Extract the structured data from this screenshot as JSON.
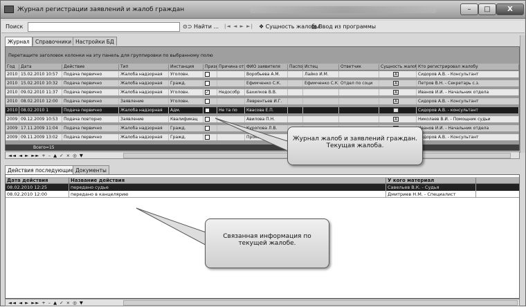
{
  "window": {
    "title": "Журнал регистрации заявлений и жалоб граждан",
    "min": "–",
    "max": "□",
    "close": "X"
  },
  "toolbar": {
    "search_label": "Поиск",
    "find": "Найти ...",
    "nav": "|◄ ◄ ► ►|",
    "entity": "Сущность жалобы",
    "input": "Ввод из программы"
  },
  "tabs_top": [
    {
      "label": "Журнал"
    },
    {
      "label": "Справочники"
    },
    {
      "label": "Настройки БД"
    }
  ],
  "grid1": {
    "group_hint": "Перетащите заголовок колонки на эту панель для группировки по выбранному полю",
    "columns": [
      "Год",
      "Дата",
      "Действие",
      "Тип",
      "Инстанция",
      "Признак",
      "Причина отказа",
      "ФИО заявителя",
      "Паспорт",
      "Истец",
      "Ответчик",
      "Сущность жалобы",
      "Кто регистрировал жалобу"
    ],
    "rows": [
      {
        "year": "2010",
        "date": "15.02.2010 10:57",
        "action": "Подача первично",
        "type": "Жалоба надзорная",
        "inst": "Уголовн.",
        "flag": "",
        "reason": "",
        "fio": "Воробьева А.М.",
        "pass": "",
        "plaintiff": "Лайко И.М.",
        "defendant": "",
        "essence": "A",
        "reg": "Сидоров А.В. - Консультант"
      },
      {
        "year": "2010",
        "date": "15.02.2010 10:32",
        "action": "Подача первично",
        "type": "Жалоба надзорная",
        "inst": "Гражд.",
        "flag": "",
        "reason": "",
        "fio": "Ефимченко С.К.",
        "pass": "",
        "plaintiff": "Ефимченко С.К.",
        "defendant": "Отдел по соци",
        "essence": "A",
        "reg": "Петров В.Н. - Секретарь с.з."
      },
      {
        "year": "2010",
        "date": "09.02.2010 11:37",
        "action": "Подача первично",
        "type": "Жалоба надзорная",
        "inst": "Уголовн.",
        "flag": "✓",
        "reason": "Недособр",
        "fio": "Бахилков В.В.",
        "pass": "",
        "plaintiff": "",
        "defendant": "",
        "essence": "A",
        "reg": "Иванов И.И. - Начальник отдела"
      },
      {
        "year": "2010",
        "date": "08.02.2010 12:00",
        "action": "Подача первично",
        "type": "Заявление",
        "inst": "Уголовн.",
        "flag": "",
        "reason": "",
        "fio": "Леврентьев И.Г.",
        "pass": "",
        "plaintiff": "",
        "defendant": "",
        "essence": "A",
        "reg": "Сидоров А.В. - Консультант"
      },
      {
        "year": "2010",
        "date": "08.02.2010 1",
        "action": "Подача первично",
        "type": "Жалоба надзорная",
        "inst": "Адм.",
        "flag": "✓",
        "reason": "Не та по",
        "fio": "Квасова Е.П.",
        "pass": "",
        "plaintiff": "",
        "defendant": "",
        "essence": "A",
        "reg": "Сидоров А.В. - консультант"
      },
      {
        "year": "2009",
        "date": "09.12.2009 10:53",
        "action": "Подача повторно",
        "type": "Заявление",
        "inst": "Квалификац",
        "flag": "",
        "reason": "",
        "fio": "Авилова П.Н.",
        "pass": "",
        "plaintiff": "",
        "defendant": "",
        "essence": "A",
        "reg": "Николаев В.И. - Помощник судьи"
      },
      {
        "year": "2009",
        "date": "17.11.2009 11:04",
        "action": "Подача первично",
        "type": "Жалоба надзорная",
        "inst": "Гражд.",
        "flag": "",
        "reason": "",
        "fio": "Куропова Л.В.",
        "pass": "",
        "plaintiff": "",
        "defendant": "",
        "essence": "A",
        "reg": "Иванов И.И. - Начальник отдела"
      },
      {
        "year": "2009",
        "date": "09.11.2009 13:02",
        "action": "Подача первично",
        "type": "Жалоба надзорная",
        "inst": "Гражд.",
        "flag": "",
        "reason": "",
        "fio": "Прокова",
        "pass": "",
        "plaintiff": "",
        "defendant": "",
        "essence": "A",
        "reg": "Сидоров А.В. - Консультант"
      }
    ],
    "total": "Всего=15"
  },
  "nav_glyphs": "◄◄ ◄ ► ►► + – ▲ ✓ × ◎ ▼",
  "tabs_bottom": [
    {
      "label": "Действия последующие"
    },
    {
      "label": "Документы"
    }
  ],
  "grid2": {
    "columns": [
      "Дата действия",
      "Название действия",
      "У кого материал"
    ],
    "rows": [
      {
        "date": "08.02.2010 12:25",
        "name": "передано судье",
        "who": "Савельев В.К. - Судья"
      },
      {
        "date": "08.02.2010 12:00",
        "name": "передано в канцелярию",
        "who": "Дмитриев Н.М. - Специалист"
      }
    ]
  },
  "callouts": {
    "c1": "Журнал жалоб и заявлений граждан. Текущая жалоба.",
    "c2": "Связанная информация по текущей жалобе."
  },
  "colors": {
    "grid_bg": "#9a9a9a",
    "selected_row": "#222222",
    "callout_border": "#555555"
  }
}
